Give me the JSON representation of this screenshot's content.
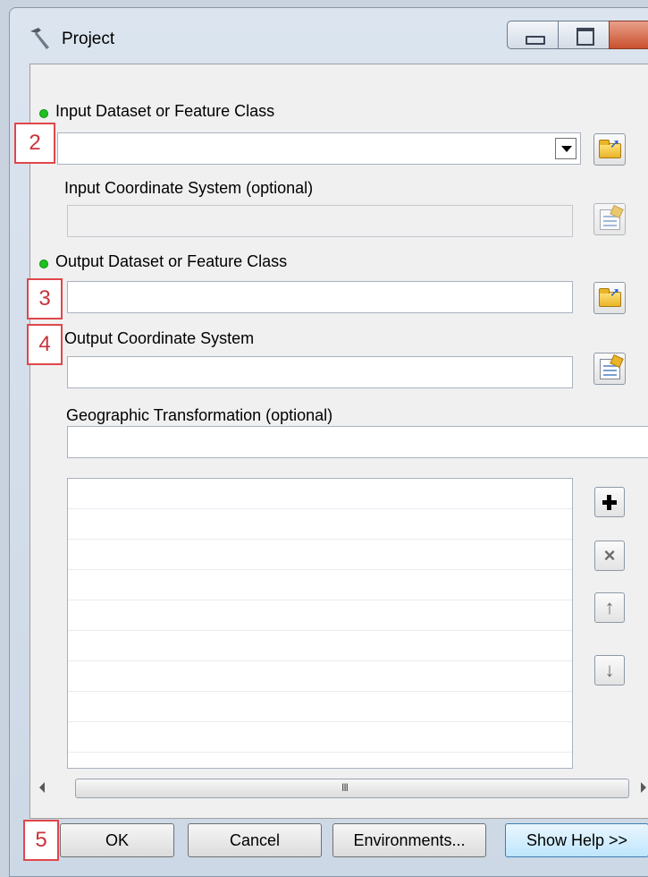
{
  "window": {
    "title": "Project"
  },
  "form": {
    "input_dataset_label": "Input Dataset or Feature Class",
    "input_dataset_value": "",
    "input_coord_label": "Input Coordinate System (optional)",
    "input_coord_value": "",
    "output_dataset_label": "Output Dataset or Feature Class",
    "output_dataset_value": "",
    "output_coord_label": "Output Coordinate System",
    "output_coord_value": "",
    "geo_transform_label": "Geographic Transformation (optional)",
    "geo_transform_value": ""
  },
  "side_buttons": {
    "add": "add",
    "remove": "×",
    "up": "↑",
    "down": "↓"
  },
  "scrollbar": {
    "grip": "III"
  },
  "buttons": {
    "ok": "OK",
    "cancel": "Cancel",
    "environments": "Environments...",
    "show_help": "Show Help >>"
  },
  "callouts": {
    "c2": "2",
    "c3": "3",
    "c4": "4",
    "c5": "5"
  },
  "colors": {
    "required_dot": "#1ec21e",
    "callout_border": "#e0464b"
  }
}
